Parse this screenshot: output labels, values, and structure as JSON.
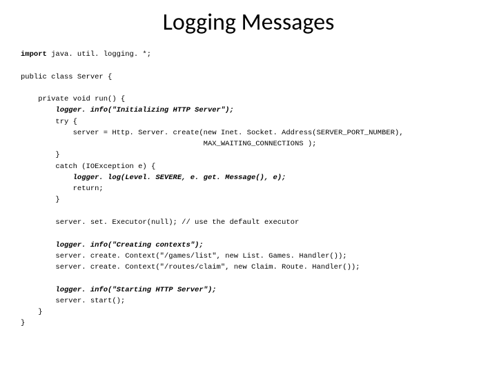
{
  "title": "Logging Messages",
  "code": {
    "l1_kw": "import",
    "l1_rest": " java. util. logging. *;",
    "l2": "public class Server {",
    "l3": "    private void run() {",
    "l4": "        logger. info(\"Initializing HTTP Server\");",
    "l5": "        try {",
    "l6": "            server = Http. Server. create(new Inet. Socket. Address(SERVER_PORT_NUMBER),",
    "l7": "                                          MAX_WAITING_CONNECTIONS );",
    "l8": "        }",
    "l9": "        catch (IOException e) {",
    "l10": "            logger. log(Level. SEVERE, e. get. Message(), e);",
    "l11": "            return;",
    "l12": "        }",
    "l13": "        server. set. Executor(null); // use the default executor",
    "l14": "        logger. info(\"Creating contexts\");",
    "l15": "        server. create. Context(\"/games/list\", new List. Games. Handler());",
    "l16": "        server. create. Context(\"/routes/claim\", new Claim. Route. Handler());",
    "l17": "        logger. info(\"Starting HTTP Server\");",
    "l18": "        server. start();",
    "l19": "    }",
    "l20": "}"
  }
}
